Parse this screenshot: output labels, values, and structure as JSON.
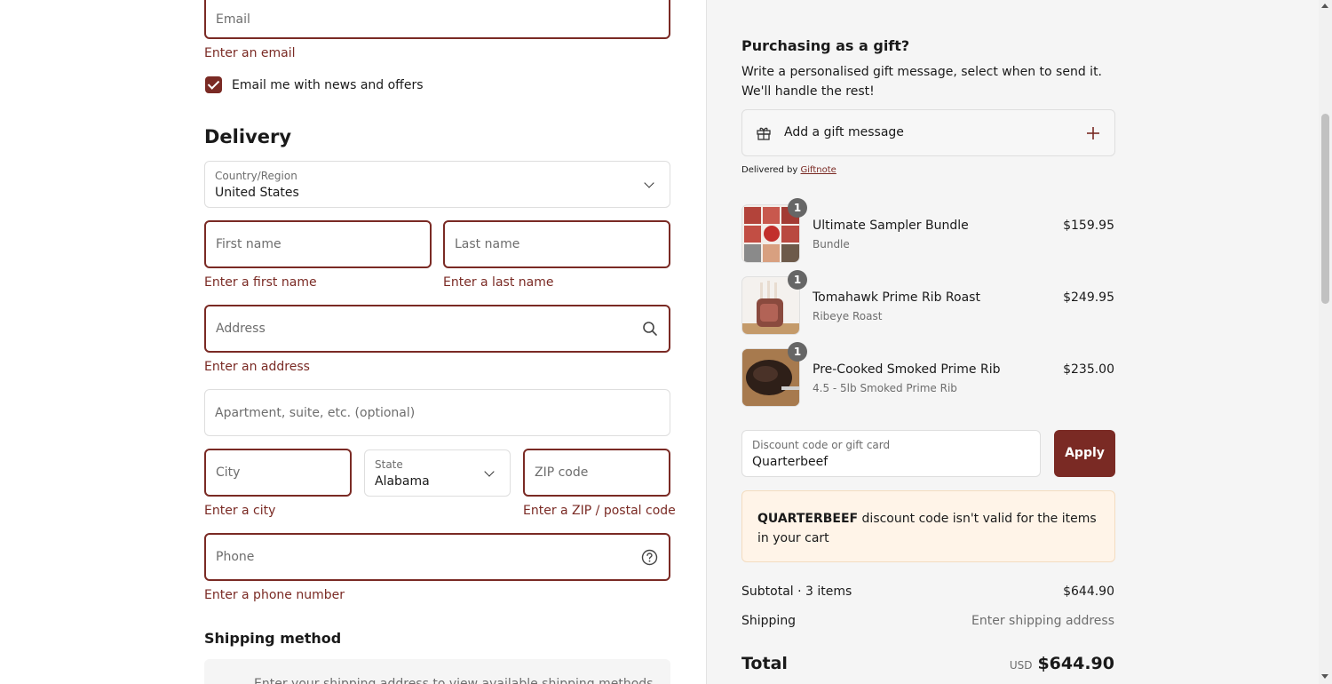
{
  "contact": {
    "email_placeholder": "Email",
    "email_error": "Enter an email",
    "newsletter_label": "Email me with news and offers",
    "newsletter_checked": true
  },
  "delivery": {
    "heading": "Delivery",
    "country_label": "Country/Region",
    "country_value": "United States",
    "first_name_placeholder": "First name",
    "first_name_error": "Enter a first name",
    "last_name_placeholder": "Last name",
    "last_name_error": "Enter a last name",
    "address_placeholder": "Address",
    "address_error": "Enter an address",
    "apartment_placeholder": "Apartment, suite, etc. (optional)",
    "city_placeholder": "City",
    "city_error": "Enter a city",
    "state_label": "State",
    "state_value": "Alabama",
    "zip_placeholder": "ZIP code",
    "zip_error": "Enter a ZIP / postal code",
    "phone_placeholder": "Phone",
    "phone_error": "Enter a phone number"
  },
  "shipping_method": {
    "heading": "Shipping method",
    "info": "Enter your shipping address to view available shipping methods."
  },
  "gift": {
    "heading": "Purchasing as a gift?",
    "description": "Write a personalised gift message, select when to send it. We'll handle the rest!",
    "add_label": "Add a gift message",
    "delivered_by": "Delivered by",
    "provider": "Giftnote"
  },
  "cart": {
    "items": [
      {
        "qty": "1",
        "name": "Ultimate Sampler Bundle",
        "variant": "Bundle",
        "price": "$159.95"
      },
      {
        "qty": "1",
        "name": "Tomahawk Prime Rib Roast",
        "variant": "Ribeye Roast",
        "price": "$249.95"
      },
      {
        "qty": "1",
        "name": "Pre-Cooked Smoked Prime Rib",
        "variant": "4.5 - 5lb Smoked Prime Rib",
        "price": "$235.00"
      }
    ]
  },
  "discount": {
    "label": "Discount code or gift card",
    "value": "Quarterbeef",
    "apply_label": "Apply",
    "notice_code": "QUARTERBEEF",
    "notice_text": " discount code isn't valid for the items in your cart"
  },
  "summary": {
    "subtotal_label": "Subtotal · 3 items",
    "subtotal_value": "$644.90",
    "shipping_label": "Shipping",
    "shipping_value": "Enter shipping address",
    "total_label": "Total",
    "currency": "USD",
    "total_value": "$644.90"
  },
  "colors": {
    "accent": "#7a2a24",
    "notice_bg": "#fff4e8"
  }
}
